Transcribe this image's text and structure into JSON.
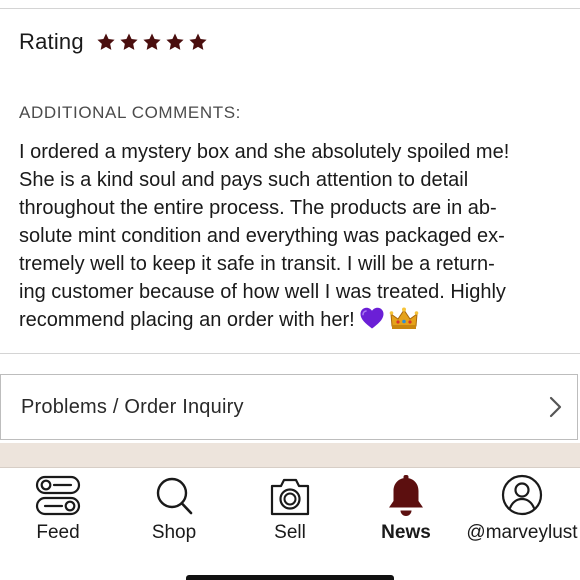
{
  "review": {
    "rating_label": "Rating",
    "star_count": 5,
    "star_color": "#4a0e0e",
    "comments_heading": "ADDITIONAL COMMENTS:",
    "comment_lines": [
      "I ordered a mystery box and she absolutely spoiled me!",
      "She is a kind soul and pays such attention to detail",
      "throughout the entire process. The products are in ab-",
      "solute mint condition and everything was packaged ex-",
      "tremely well to keep it safe in transit. I will be a return-",
      "ing customer because of how well I was treated. Highly",
      "recommend placing an order with her!"
    ],
    "comment_emojis": [
      "purple-heart",
      "crown"
    ]
  },
  "inquiry": {
    "label": "Problems / Order Inquiry",
    "icon": "chevron-right-icon"
  },
  "tabbar": {
    "tabs": [
      {
        "label": "Feed",
        "icon": "feed-icon",
        "active": false
      },
      {
        "label": "Shop",
        "icon": "search-icon",
        "active": false
      },
      {
        "label": "Sell",
        "icon": "camera-icon",
        "active": false
      },
      {
        "label": "News",
        "icon": "bell-icon",
        "active": true
      },
      {
        "label": "@marveylust",
        "icon": "profile-icon",
        "active": false
      }
    ],
    "active_color": "#5c0f0f"
  },
  "colors": {
    "band": "#ede4dc",
    "heading": "#4b4b4b"
  }
}
